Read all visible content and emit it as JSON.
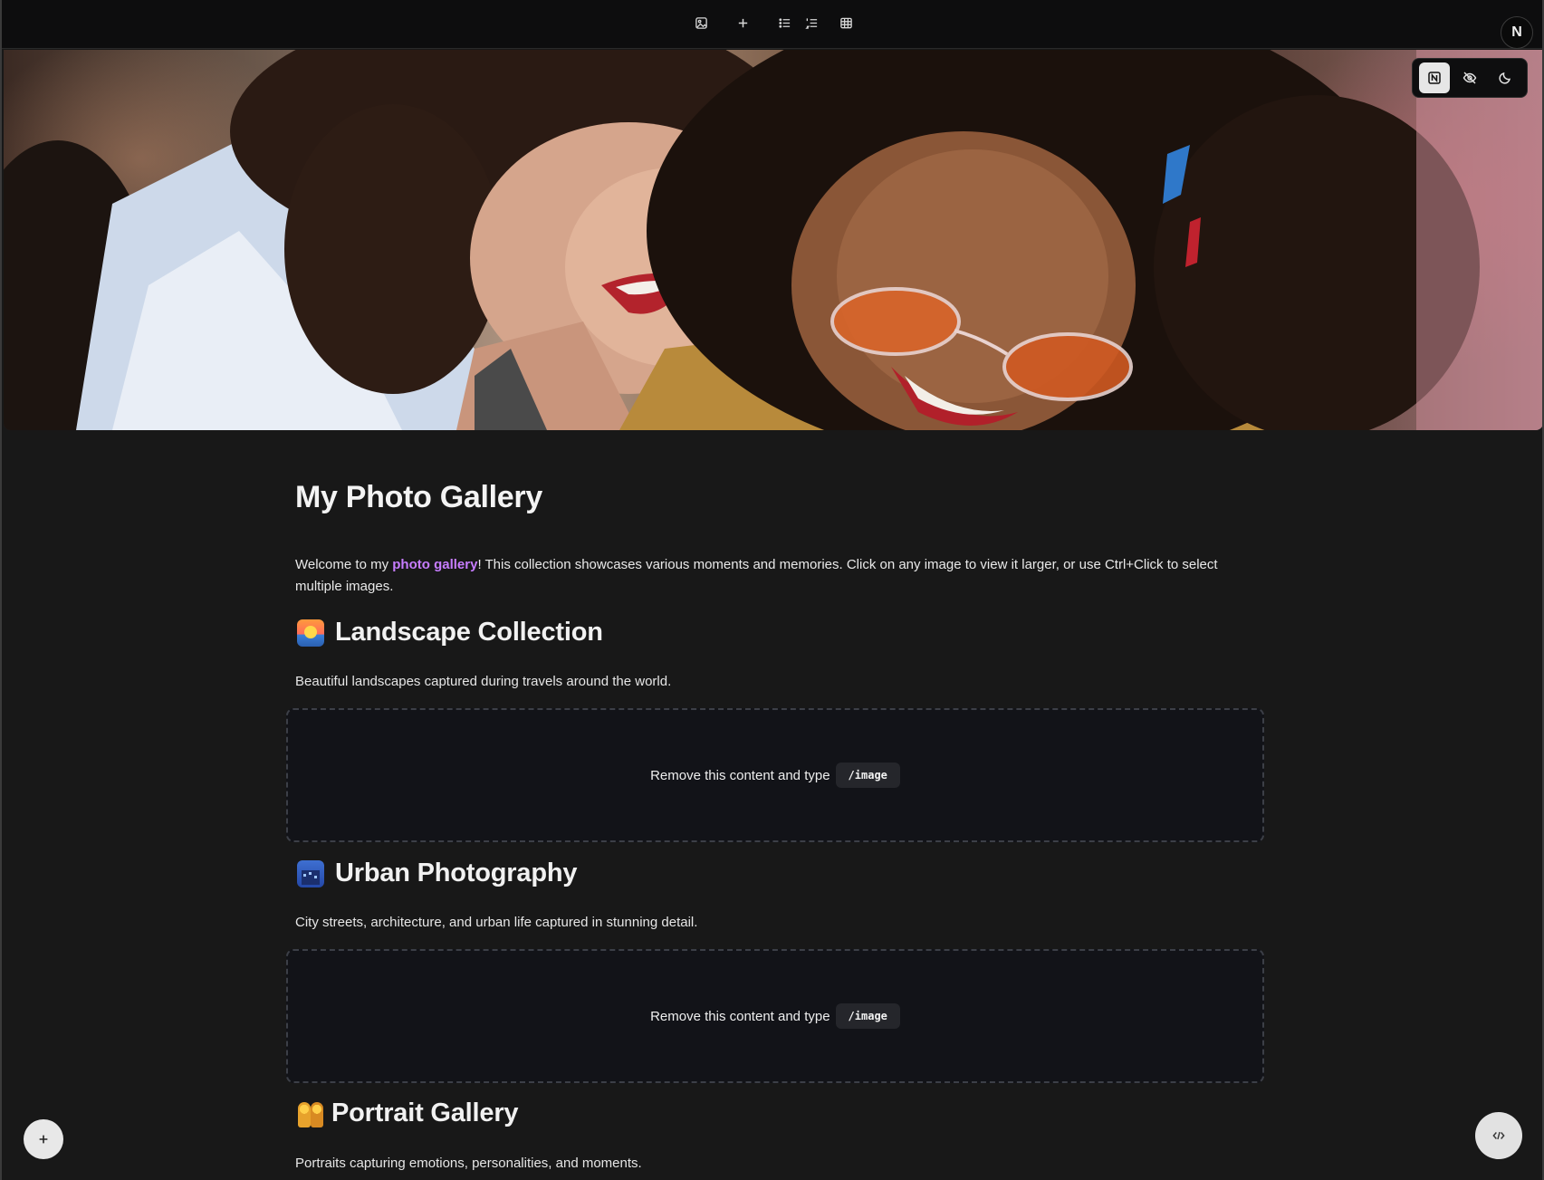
{
  "toolbar": {
    "buttons": [
      {
        "icon": "image-icon"
      },
      {
        "icon": "plus-icon"
      },
      {
        "icon": "bullet-list-icon"
      },
      {
        "icon": "numbered-list-icon"
      },
      {
        "icon": "table-icon"
      }
    ],
    "avatar_letter": "N"
  },
  "cover_controls": {
    "buttons": [
      {
        "icon": "notion-logo-icon",
        "active": true
      },
      {
        "icon": "eye-off-icon",
        "active": false
      },
      {
        "icon": "moon-icon",
        "active": false
      }
    ]
  },
  "page": {
    "title": "My Photo Gallery",
    "intro_before": "Welcome to my ",
    "intro_highlight": "photo gallery",
    "intro_after": "! This collection showcases various moments and memories. Click on any image to view it larger, or use Ctrl+Click to select multiple images.",
    "highlight_color": "#c77dff"
  },
  "sections": [
    {
      "emoji": "sunrise-over-water",
      "heading": "Landscape Collection",
      "description": "Beautiful landscapes captured during travels around the world.",
      "placeholder_text": "Remove this content and type",
      "placeholder_command": "/image"
    },
    {
      "emoji": "cityscape",
      "heading": "Urban Photography",
      "description": "City streets, architecture, and urban life captured in stunning detail.",
      "placeholder_text": "Remove this content and type",
      "placeholder_command": "/image"
    },
    {
      "emoji": "people-holding-hands",
      "heading": "Portrait Gallery",
      "description": "Portraits capturing emotions, personalities, and moments."
    }
  ],
  "fab": {
    "add_icon": "plus-icon",
    "code_icon": "code-icon"
  }
}
